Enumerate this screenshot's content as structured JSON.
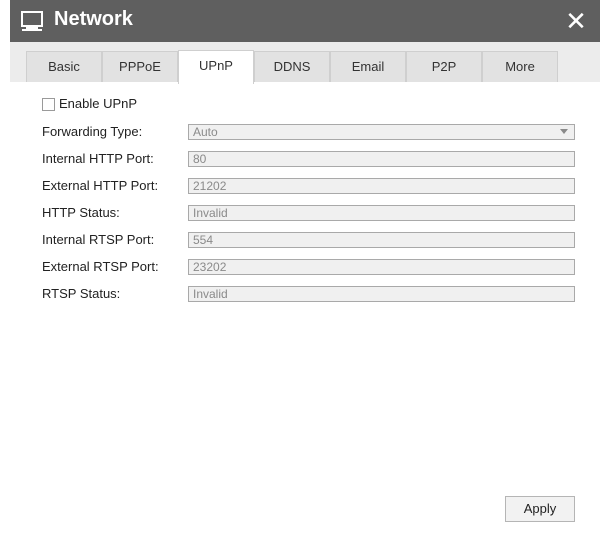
{
  "window": {
    "title": "Network",
    "close_label": "✕"
  },
  "tabs": [
    {
      "label": "Basic"
    },
    {
      "label": "PPPoE"
    },
    {
      "label": "UPnP"
    },
    {
      "label": "DDNS"
    },
    {
      "label": "Email"
    },
    {
      "label": "P2P"
    },
    {
      "label": "More"
    }
  ],
  "active_tab": "UPnP",
  "form": {
    "enable_upnp": {
      "label": "Enable UPnP",
      "checked": false
    },
    "forwarding_type": {
      "label": "Forwarding Type:",
      "value": "Auto"
    },
    "internal_http_port": {
      "label": "Internal HTTP Port:",
      "value": "80"
    },
    "external_http_port": {
      "label": "External HTTP Port:",
      "value": "21202"
    },
    "http_status": {
      "label": "HTTP Status:",
      "value": "Invalid"
    },
    "internal_rtsp_port": {
      "label": "Internal RTSP Port:",
      "value": "554"
    },
    "external_rtsp_port": {
      "label": "External RTSP Port:",
      "value": "23202"
    },
    "rtsp_status": {
      "label": "RTSP Status:",
      "value": "Invalid"
    }
  },
  "apply_label": "Apply",
  "colors": {
    "titlebar": "#5f5f5f",
    "tabstrip": "#ececec",
    "field_bg": "#f0f0f0"
  }
}
